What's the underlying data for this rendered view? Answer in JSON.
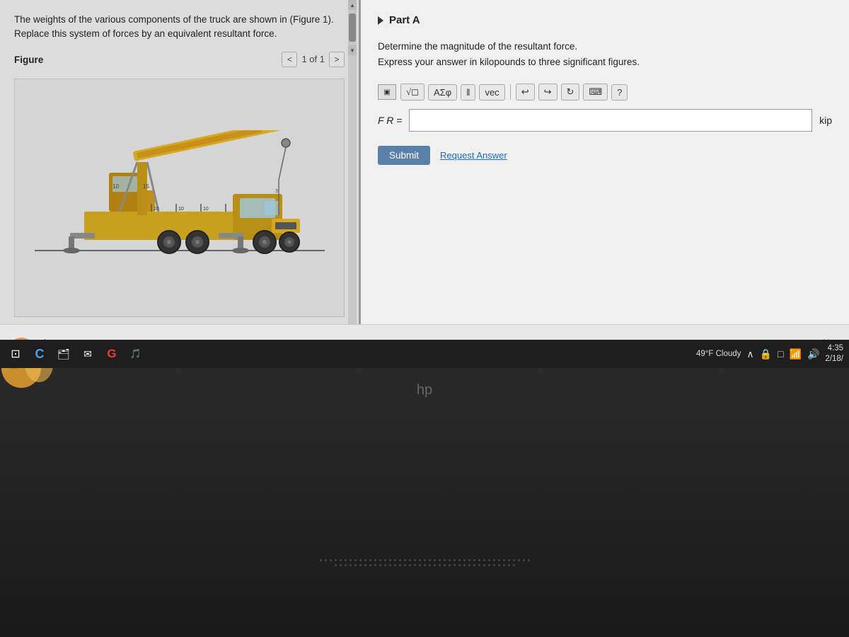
{
  "left_panel": {
    "problem_text": "The weights of the various components of the truck are shown in (Figure 1). Replace this system of forces by an equivalent resultant force.",
    "figure_label": "Figure",
    "nav_label": "1 of 1",
    "nav_prev_label": "<",
    "nav_next_label": ">"
  },
  "right_panel": {
    "part_title": "Part A",
    "question_line1": "Determine the magnitude of the resultant force.",
    "question_line2": "Express your answer in kilopounds to three significant figures.",
    "toolbar": {
      "sqrt_label": "√◻",
      "alpha_label": "AΣφ",
      "pipe_label": "‖",
      "vec_label": "vec",
      "undo_label": "↩",
      "redo_label": "↪",
      "refresh_label": "↻",
      "keyboard_label": "⌨",
      "help_label": "?"
    },
    "input": {
      "fr_label": "F R =",
      "placeholder": "",
      "unit": "kip"
    },
    "buttons": {
      "submit_label": "Submit",
      "request_label": "Request Answer"
    }
  },
  "bottom_nav": {
    "prev_label": "◀ Previous",
    "next_label": "Ne"
  },
  "taskbar": {
    "icons": [
      "⊡",
      "C",
      "🗂",
      "✉",
      "G",
      "🎵"
    ],
    "weather": "49°F Cloudy",
    "time": "4:35",
    "date": "2/18/"
  },
  "colors": {
    "submit_bg": "#5a7fa8",
    "link_color": "#1a6acc",
    "part_triangle": "#333"
  }
}
